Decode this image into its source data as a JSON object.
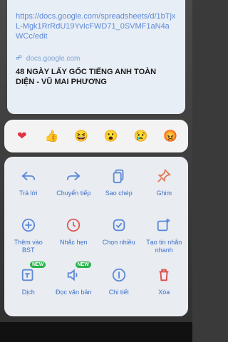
{
  "link_card": {
    "url": "https://docs.google.com/spreadsheets/d/1bTjxL-Mgk1RrRdU19YvIcFWD71_0SVMF1aN4aWCc/edit",
    "domain": "docs.google.com",
    "title": "48 NGÀY LẤY GỐC TIẾNG ANH TOÀN DIỆN - VŨ MAI PHƯƠNG"
  },
  "reactions": [
    {
      "icon": "heart-icon",
      "glyph": "❤"
    },
    {
      "icon": "thumbs-up-icon",
      "glyph": "👍"
    },
    {
      "icon": "laughing-face-icon",
      "glyph": "😆"
    },
    {
      "icon": "surprised-face-icon",
      "glyph": "😮"
    },
    {
      "icon": "crying-face-icon",
      "glyph": "😢"
    },
    {
      "icon": "angry-face-icon",
      "glyph": "😡"
    }
  ],
  "actions": [
    {
      "label": "Trả lời",
      "icon": "reply-icon"
    },
    {
      "label": "Chuyển tiếp",
      "icon": "forward-icon"
    },
    {
      "label": "Sao chép",
      "icon": "copy-icon"
    },
    {
      "label": "Ghim",
      "icon": "pin-icon"
    },
    {
      "label": "Thêm vào BST",
      "icon": "add-collection-icon"
    },
    {
      "label": "Nhắc hẹn",
      "icon": "clock-icon"
    },
    {
      "label": "Chọn nhiều",
      "icon": "multi-select-icon"
    },
    {
      "label": "Tạo tin nhắn nhanh",
      "icon": "quick-message-icon"
    },
    {
      "label": "Dịch",
      "icon": "translate-icon",
      "badge": "NEW"
    },
    {
      "label": "Đọc văn bản",
      "icon": "speaker-icon",
      "badge": "NEW"
    },
    {
      "label": "Chi tiết",
      "icon": "info-icon"
    },
    {
      "label": "Xóa",
      "icon": "trash-icon"
    }
  ],
  "colors": {
    "accent": "#3b6fc8",
    "badge": "#27b34a",
    "delete": "#e04848"
  }
}
